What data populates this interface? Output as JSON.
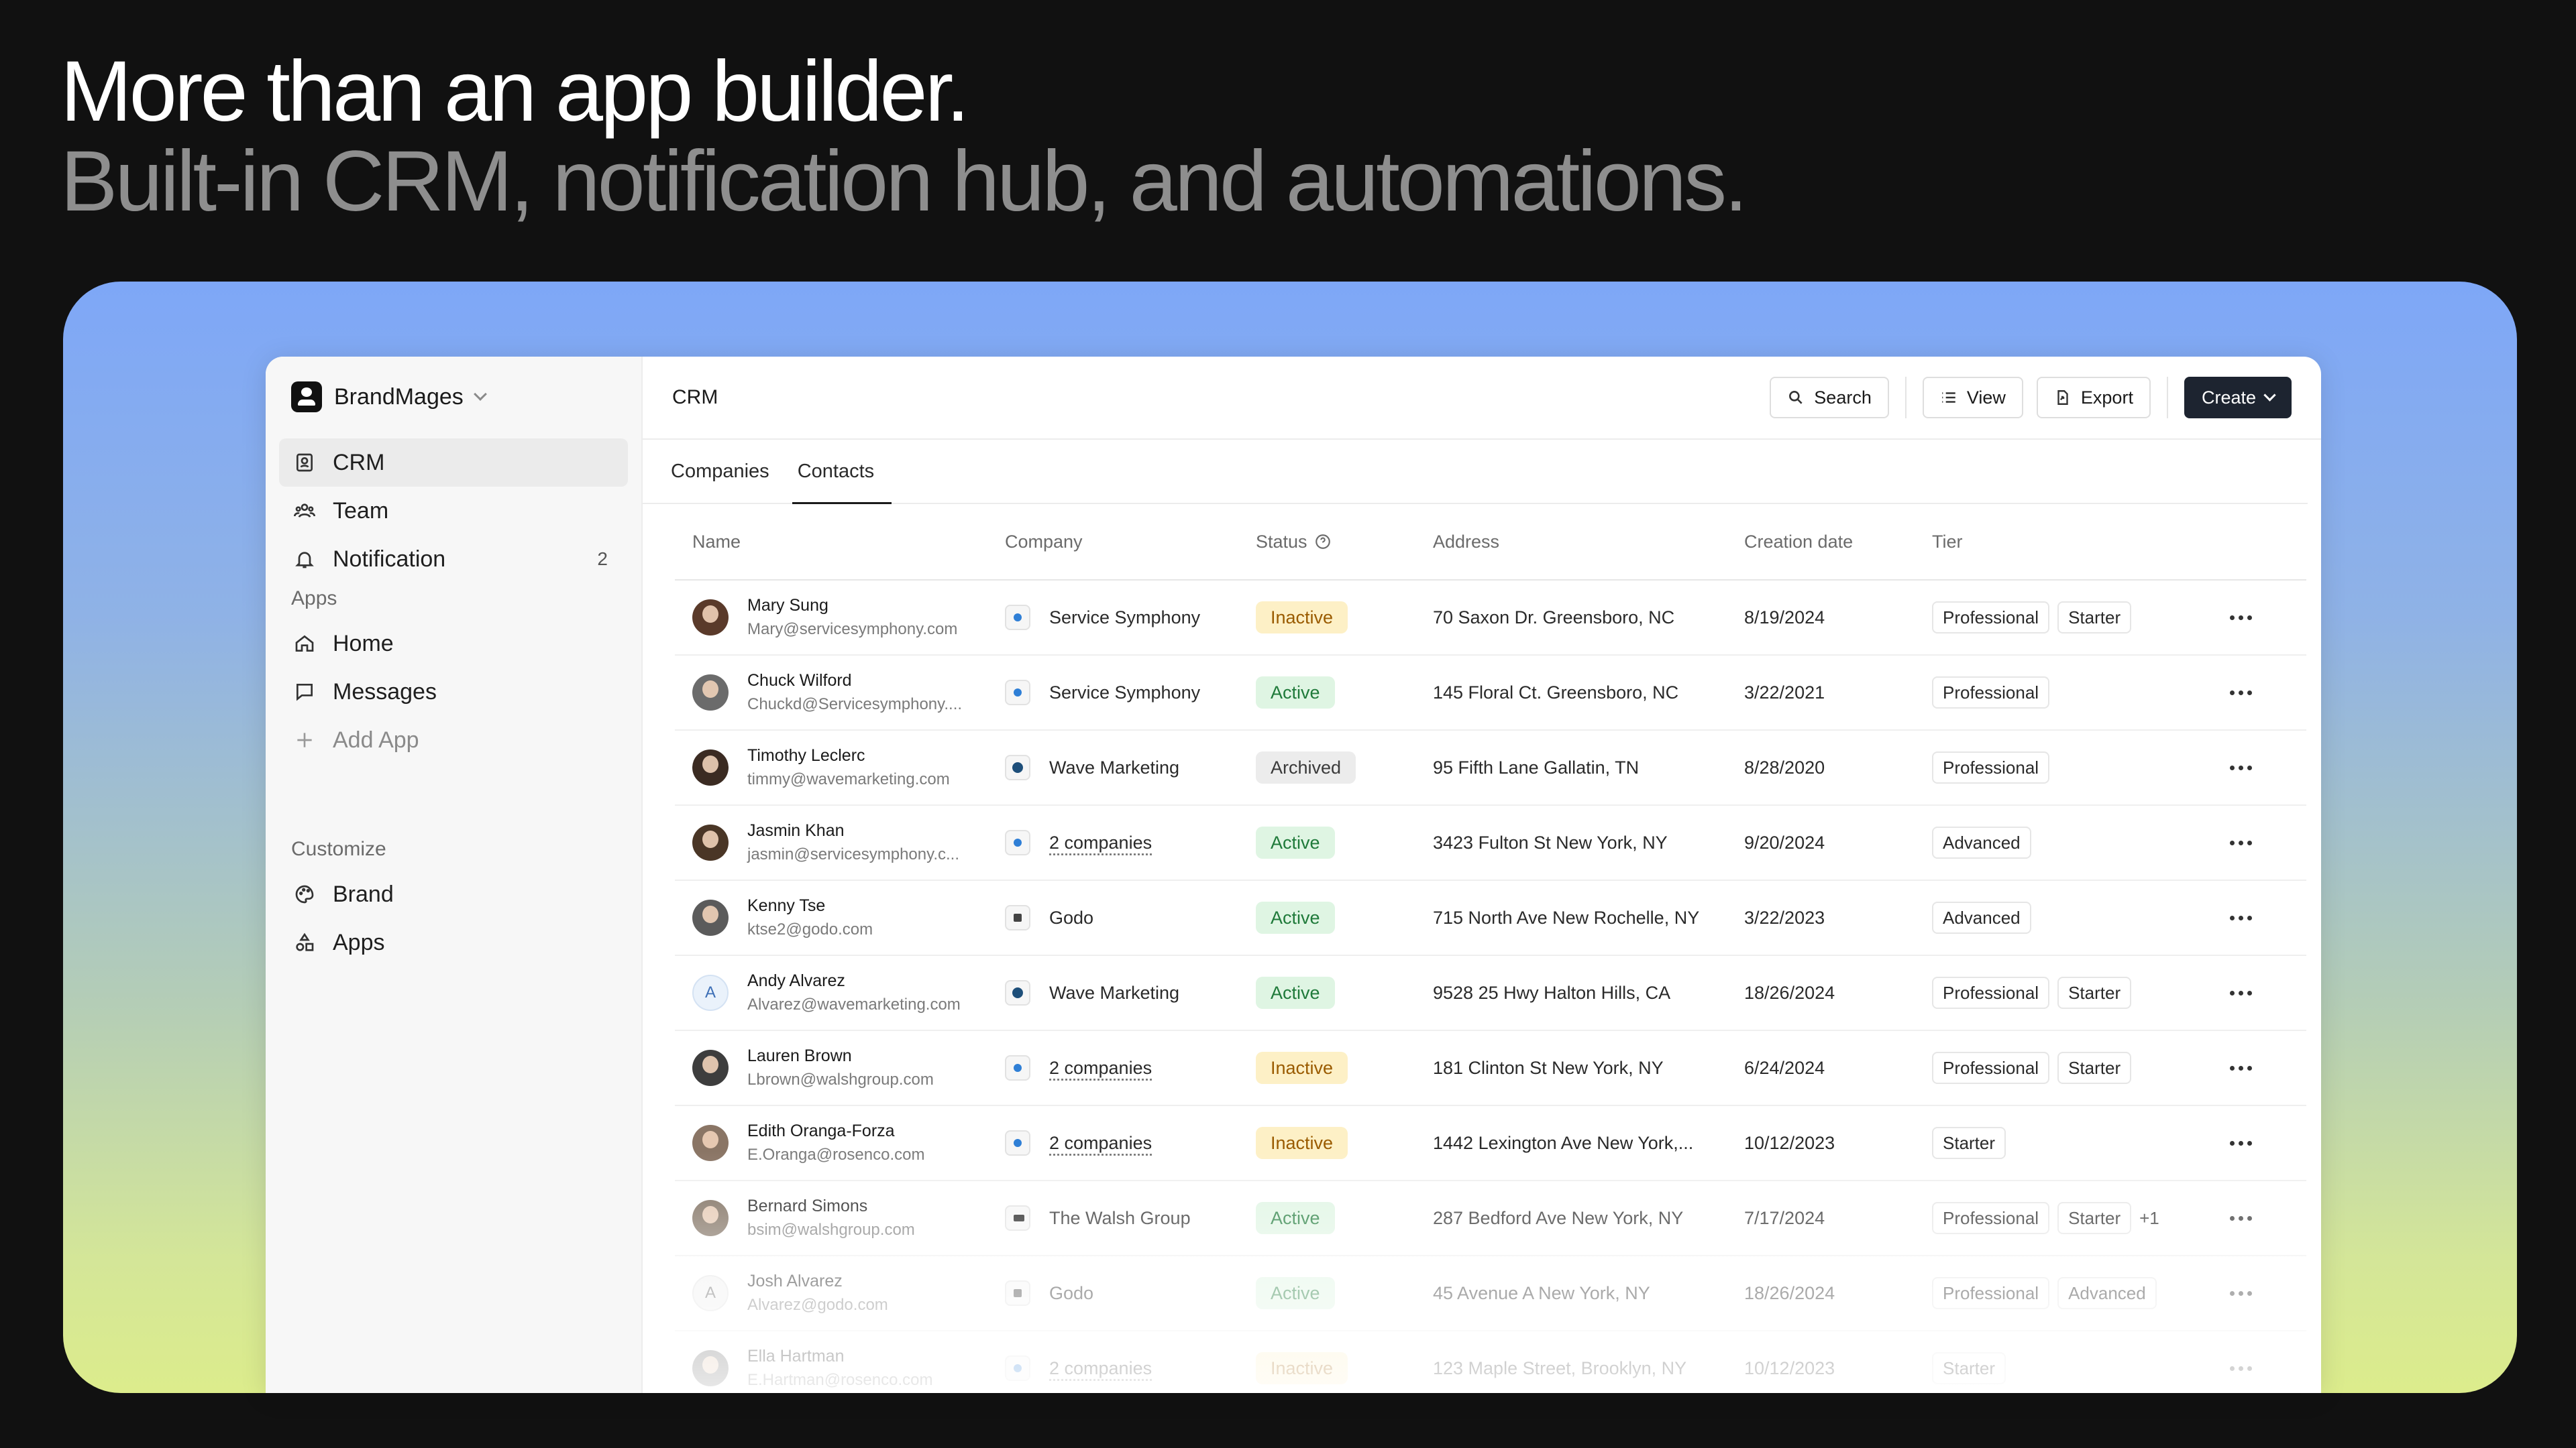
{
  "headline": {
    "line1": "More than an app builder.",
    "line2": "Built-in CRM, notification hub, and automations."
  },
  "sidebar": {
    "workspace": "BrandMages",
    "items": [
      {
        "label": "CRM",
        "icon": "contact-book-icon",
        "active": true
      },
      {
        "label": "Team",
        "icon": "team-icon"
      },
      {
        "label": "Notification",
        "icon": "bell-icon",
        "count": "2"
      }
    ],
    "apps_label": "Apps",
    "apps": [
      {
        "label": "Home",
        "icon": "home-icon"
      },
      {
        "label": "Messages",
        "icon": "message-icon"
      },
      {
        "label": "Add App",
        "icon": "plus-icon"
      }
    ],
    "customize_label": "Customize",
    "customize": [
      {
        "label": "Brand",
        "icon": "palette-icon"
      },
      {
        "label": "Apps",
        "icon": "shapes-icon"
      }
    ]
  },
  "header": {
    "title": "CRM",
    "search": "Search",
    "view": "View",
    "export": "Export",
    "create": "Create"
  },
  "tabs": [
    "Companies",
    "Contacts"
  ],
  "active_tab": "Contacts",
  "table": {
    "columns": [
      "Name",
      "Company",
      "Status",
      "Address",
      "Creation date",
      "Tier"
    ],
    "rows": [
      {
        "name": "Mary Sung",
        "email": "Mary@servicesymphony.com",
        "company": "Service Symphony",
        "status": "Inactive",
        "address": "70 Saxon Dr. Greensboro, NC",
        "date": "8/19/2024",
        "tiers": [
          "Professional",
          "Starter"
        ]
      },
      {
        "name": "Chuck Wilford",
        "email": "Chuckd@Servicesymphony....",
        "company": "Service Symphony",
        "status": "Active",
        "address": "145 Floral Ct. Greensboro, NC",
        "date": "3/22/2021",
        "tiers": [
          "Professional"
        ]
      },
      {
        "name": "Timothy Leclerc",
        "email": "timmy@wavemarketing.com",
        "company": "Wave Marketing",
        "status": "Archived",
        "address": "95 Fifth Lane Gallatin, TN",
        "date": "8/28/2020",
        "tiers": [
          "Professional"
        ]
      },
      {
        "name": "Jasmin Khan",
        "email": "jasmin@servicesymphony.c...",
        "company": "2 companies",
        "status": "Active",
        "address": "3423 Fulton St New York, NY",
        "date": "9/20/2024",
        "tiers": [
          "Advanced"
        ]
      },
      {
        "name": "Kenny Tse",
        "email": "ktse2@godo.com",
        "company": "Godo",
        "status": "Active",
        "address": "715 North Ave New Rochelle, NY",
        "date": "3/22/2023",
        "tiers": [
          "Advanced"
        ]
      },
      {
        "name": "Andy Alvarez",
        "email": "Alvarez@wavemarketing.com",
        "company": "Wave Marketing",
        "status": "Active",
        "address": "9528 25 Hwy Halton Hills, CA",
        "date": "18/26/2024",
        "tiers": [
          "Professional",
          "Starter"
        ]
      },
      {
        "name": "Lauren Brown",
        "email": "Lbrown@walshgroup.com",
        "company": "2 companies",
        "status": "Inactive",
        "address": "181 Clinton St New York, NY",
        "date": "6/24/2024",
        "tiers": [
          "Professional",
          "Starter"
        ]
      },
      {
        "name": "Edith Oranga-Forza",
        "email": "E.Oranga@rosenco.com",
        "company": "2 companies",
        "status": "Inactive",
        "address": "1442 Lexington Ave New York,...",
        "date": "10/12/2023",
        "tiers": [
          "Starter"
        ]
      },
      {
        "name": "Bernard Simons",
        "email": "bsim@walshgroup.com",
        "company": "The Walsh Group",
        "status": "Active",
        "address": "287 Bedford Ave New York, NY",
        "date": "7/17/2024",
        "tiers": [
          "Professional",
          "Starter"
        ],
        "extra": "+1"
      },
      {
        "name": "Josh Alvarez",
        "email": "Alvarez@godo.com",
        "company": "Godo",
        "status": "Active",
        "address": "45 Avenue A New York, NY",
        "date": "18/26/2024",
        "tiers": [
          "Professional",
          "Advanced"
        ]
      },
      {
        "name": "Ella Hartman",
        "email": "E.Hartman@rosenco.com",
        "company": "2 companies",
        "status": "Inactive",
        "address": "123 Maple Street, Brooklyn, NY",
        "date": "10/12/2023",
        "tiers": [
          "Starter"
        ]
      }
    ]
  },
  "colors": {
    "page_bg": "#111111",
    "gradient_top": "#7ea7f7",
    "gradient_bottom": "#dcec8c",
    "status_active": "#dff5e3",
    "status_inactive": "#fdf0c6",
    "status_archived": "#ececec",
    "primary_button": "#1d2430"
  }
}
